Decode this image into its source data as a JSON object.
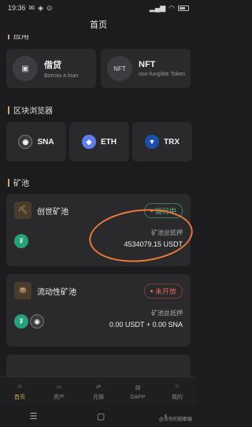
{
  "status_bar": {
    "time": "19:36",
    "battery_percent": 45
  },
  "header": {
    "title": "首页"
  },
  "sections": {
    "apps_title_partial": "应用",
    "explorer_title": "区块浏览器",
    "mining_title": "矿池"
  },
  "apps": [
    {
      "title": "借贷",
      "subtitle": "Borrow a loan",
      "icon": "wallet-icon"
    },
    {
      "title": "NFT",
      "subtitle": "non-fungible Token",
      "icon": "nft-icon"
    }
  ],
  "chains": [
    {
      "label": "SNA",
      "icon": "sna-icon",
      "color": "#3a3a3e"
    },
    {
      "label": "ETH",
      "icon": "eth-icon",
      "color": "#627eea"
    },
    {
      "label": "TRX",
      "icon": "trx-icon",
      "color": "#1b4fa8"
    }
  ],
  "pools": [
    {
      "name": "创世矿池",
      "status": "运行中",
      "status_type": "running",
      "stake_label": "矿池总抵押",
      "stake_value": "4534079.15 USDT"
    },
    {
      "name": "流动性矿池",
      "status": "未开放",
      "status_type": "closed",
      "stake_label": "矿池总抵押",
      "stake_value": "0.00 USDT + 0.00 SNA"
    }
  ],
  "tabs": [
    {
      "label": "首页",
      "icon": "home-icon",
      "active": true
    },
    {
      "label": "资产",
      "icon": "wallet-icon",
      "active": false
    },
    {
      "label": "兑换",
      "icon": "swap-icon",
      "active": false
    },
    {
      "label": "DAPP",
      "icon": "dapp-icon",
      "active": false
    },
    {
      "label": "我的",
      "icon": "user-icon",
      "active": false
    }
  ],
  "watermark": "@去你的腿都骗",
  "colors": {
    "accent": "#d9a55a",
    "annotation": "#e97a3a",
    "running": "#5bc28a",
    "closed": "#e06a5a"
  }
}
